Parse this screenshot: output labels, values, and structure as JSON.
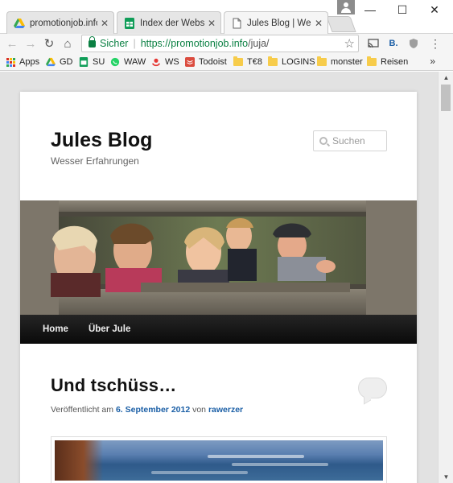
{
  "browser": {
    "tabs": [
      {
        "title": "promotionjob.info",
        "close": "✕"
      },
      {
        "title": "Index der Webseiten",
        "close": "✕"
      },
      {
        "title": "Jules Blog | Wesser",
        "close": "✕"
      }
    ],
    "window_controls": {
      "minimize": "—",
      "maximize": "☐",
      "close": "✕"
    },
    "omnibox": {
      "security_label": "Sicher",
      "url_scheme": "https://",
      "url_host": "promotionjob.info",
      "url_path": "/juja/"
    },
    "extension_b_label": "B.",
    "bookmarks": [
      {
        "label": "Apps",
        "icon": "apps-grid-icon"
      },
      {
        "label": "GD",
        "icon": "google-drive-icon",
        "color": "#34a853"
      },
      {
        "label": "SU",
        "icon": "google-sheets-icon",
        "color": "#0f9d58"
      },
      {
        "label": "WAW",
        "icon": "whatsapp-icon",
        "color": "#25d366"
      },
      {
        "label": "WS",
        "icon": "ws-icon",
        "color": "#e53935"
      },
      {
        "label": "Todoist",
        "icon": "todoist-icon",
        "color": "#db4c3f"
      },
      {
        "label": "T€8",
        "icon": "folder-icon"
      },
      {
        "label": "LOGINS",
        "icon": "folder-icon"
      },
      {
        "label": "monster",
        "icon": "folder-icon"
      },
      {
        "label": "Reisen",
        "icon": "folder-icon"
      }
    ],
    "more_bookmarks": "»"
  },
  "site": {
    "title": "Jules Blog",
    "description": "Wesser Erfahrungen",
    "search_placeholder": "Suchen",
    "nav": [
      "Home",
      "Über Jule"
    ]
  },
  "post": {
    "title": "Und tschüss…",
    "meta_prefix": "Veröffentlicht am",
    "date": "6. September 2012",
    "meta_by": "von",
    "author": "rawerzer"
  },
  "colors": {
    "accent_link": "#1b5fa6",
    "secure_green": "#0b8043",
    "nav_bg": "#111111"
  }
}
